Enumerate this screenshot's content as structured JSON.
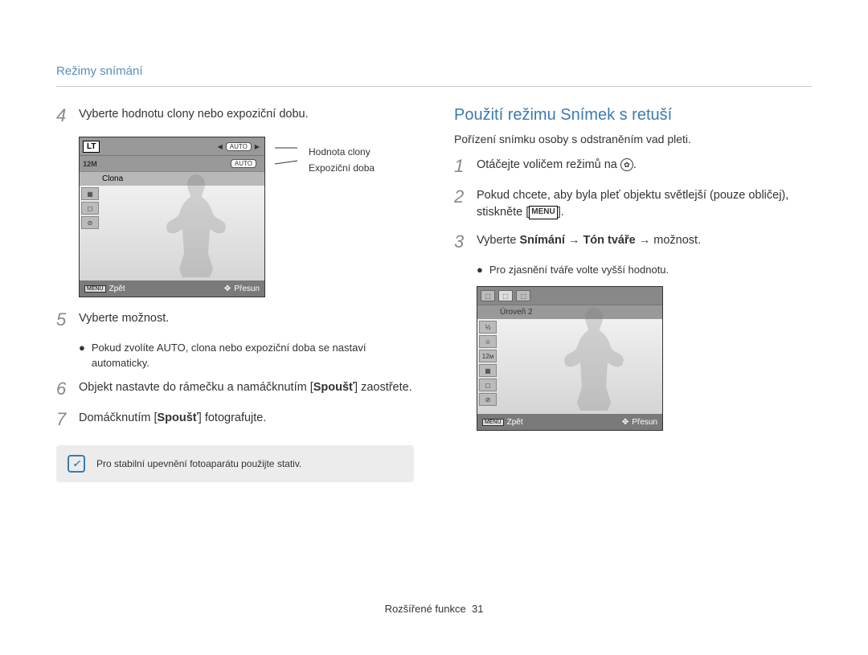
{
  "breadcrumb": "Režimy snímání",
  "left": {
    "step4": "Vyberte hodnotu clony nebo expoziční dobu.",
    "screenshot1": {
      "lt": "LT",
      "auto": "AUTO",
      "icon12m": "12M",
      "clona": "Clona",
      "menu": "MENU",
      "back": "Zpět",
      "move": "Přesun"
    },
    "labels": {
      "aperture": "Hodnota clony",
      "exposure": "Expoziční doba"
    },
    "step5": "Vyberte možnost.",
    "step5_sub_prefix": "Pokud zvolíte ",
    "step5_sub_bold": "AUTO",
    "step5_sub_suffix": ", clona nebo expoziční doba se nastaví automaticky.",
    "step6_prefix": "Objekt nastavte do rámečku a namáčknutím [",
    "step6_bold": "Spoušť",
    "step6_suffix": "] zaostřete.",
    "step7_prefix": "Domáčknutím [",
    "step7_bold": "Spoušť",
    "step7_suffix": "] fotografujte.",
    "note": "Pro stabilní upevnění fotoaparátu použijte stativ."
  },
  "right": {
    "title": "Použití režimu Snímek s retuší",
    "intro": "Pořízení snímku osoby s odstraněním vad pleti.",
    "step1": "Otáčejte voličem režimů na ",
    "step2_prefix": "Pokud chcete, aby byla pleť objektu světlejší (pouze obličej), stiskněte [",
    "step2_menu": "MENU",
    "step2_suffix": "].",
    "step3_prefix": "Vyberte ",
    "step3_b1": "Snímání",
    "step3_arrow": " → ",
    "step3_b2": "Tón tváře",
    "step3_suffix": " → možnost.",
    "step3_sub": "Pro zjasnění tváře volte vyšší hodnotu.",
    "screenshot2": {
      "level": "Úroveň 2",
      "menu": "MENU",
      "back": "Zpět",
      "move": "Přesun"
    }
  },
  "footer": {
    "section": "Rozšířené funkce",
    "page": "31"
  }
}
